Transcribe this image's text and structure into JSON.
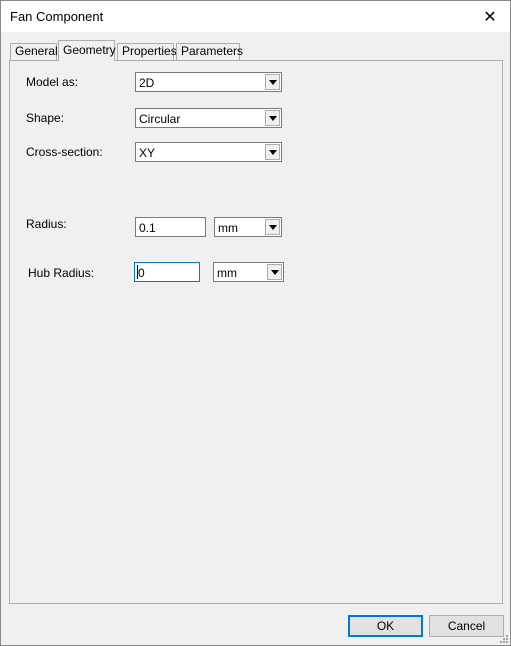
{
  "window": {
    "title": "Fan Component"
  },
  "tabs": [
    {
      "label": "General"
    },
    {
      "label": "Geometry"
    },
    {
      "label": "Properties"
    },
    {
      "label": "Parameters"
    }
  ],
  "active_tab": "Geometry",
  "fields": {
    "model_as": {
      "label": "Model as:",
      "value": "2D"
    },
    "shape": {
      "label": "Shape:",
      "value": "Circular"
    },
    "cross_section": {
      "label": "Cross-section:",
      "value": "XY"
    },
    "radius": {
      "label": "Radius:",
      "value": "0.1",
      "unit": "mm"
    },
    "hub_radius": {
      "label": "Hub Radius:",
      "value": "0",
      "unit": "mm"
    }
  },
  "buttons": {
    "ok": "OK",
    "cancel": "Cancel"
  },
  "colors": {
    "focus_border": "#0078d7",
    "panel_bg": "#f0f0f0"
  }
}
